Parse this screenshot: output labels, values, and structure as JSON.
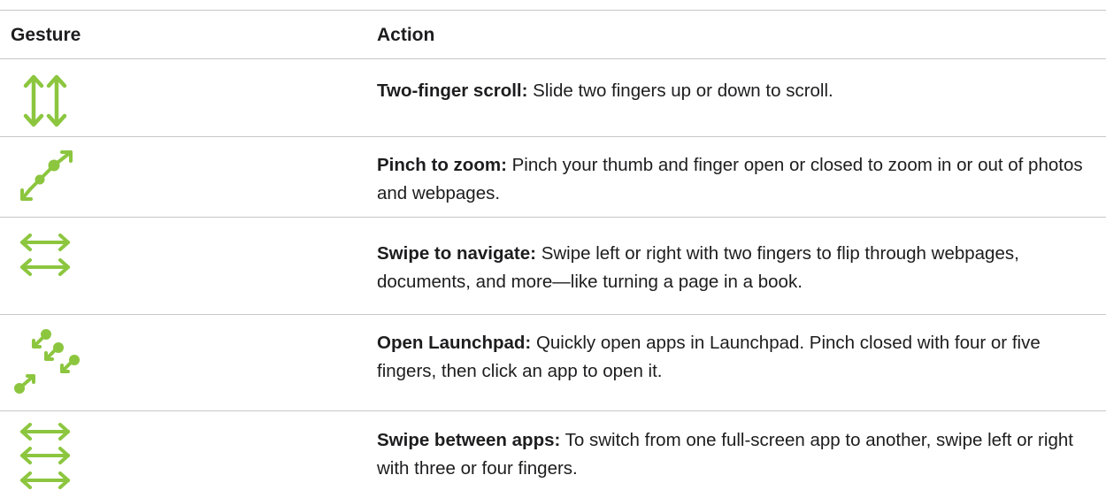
{
  "header": {
    "gesture": "Gesture",
    "action": "Action"
  },
  "accent_color": "#8cc63f",
  "rows": [
    {
      "icon": "two-finger-scroll-icon",
      "term": "Two-finger scroll:",
      "text": "Slide two fingers up or down to scroll."
    },
    {
      "icon": "pinch-zoom-icon",
      "term": "Pinch to zoom:",
      "text": "Pinch your thumb and finger open or closed to zoom in or out of photos and webpages."
    },
    {
      "icon": "swipe-navigate-icon",
      "term": "Swipe to navigate:",
      "text": "Swipe left or right with two fingers to flip through webpages, documents, and more—like turning a page in a book."
    },
    {
      "icon": "launchpad-pinch-icon",
      "term": "Open Launchpad:",
      "text": "Quickly open apps in Launchpad. Pinch closed with four or five fingers, then click an app to open it."
    },
    {
      "icon": "swipe-apps-icon",
      "term": "Swipe between apps:",
      "text": "To switch from one full-screen app to another, swipe left or right with three or four fingers."
    }
  ]
}
